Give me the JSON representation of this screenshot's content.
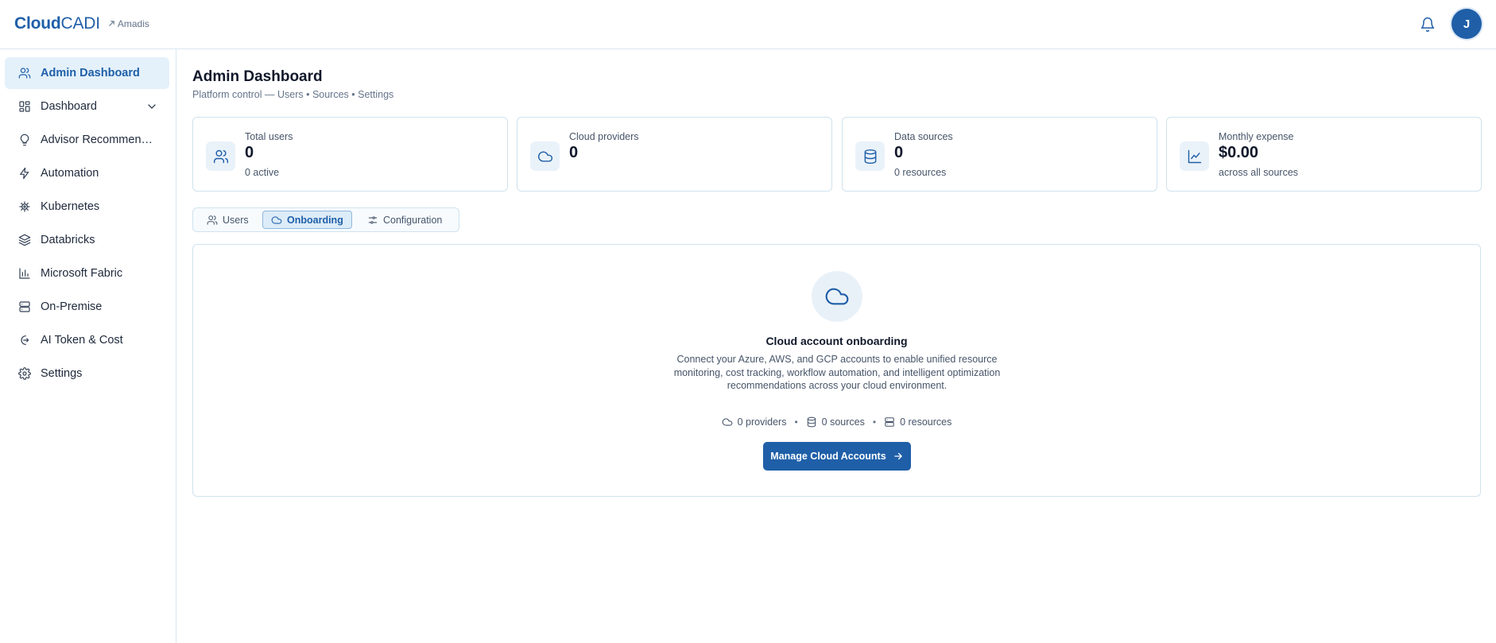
{
  "header": {
    "brand_strong": "Cloud",
    "brand_light": "CADI",
    "tenant": "Amadis",
    "avatar_initial": "J",
    "icons": {
      "tenant": "external-link-icon",
      "notifications": "bell-icon"
    }
  },
  "colors": {
    "primary": "#1f5fa8",
    "active_nav_bg": "#e4f1fb",
    "border": "#cfe2ee",
    "text_muted": "#475569"
  },
  "sidebar": {
    "items": [
      {
        "label": "Admin Dashboard",
        "icon": "users-icon",
        "active": true
      },
      {
        "label": "Dashboard",
        "icon": "grid-icon",
        "expandable": true
      },
      {
        "label": "Advisor Recommendations",
        "icon": "lightbulb-icon"
      },
      {
        "label": "Automation",
        "icon": "lightning-icon"
      },
      {
        "label": "Kubernetes",
        "icon": "helm-icon"
      },
      {
        "label": "Databricks",
        "icon": "layers-icon"
      },
      {
        "label": "Microsoft Fabric",
        "icon": "bar-chart-icon"
      },
      {
        "label": "On-Premise",
        "icon": "server-icon"
      },
      {
        "label": "AI Token & Cost",
        "icon": "token-icon"
      },
      {
        "label": "Settings",
        "icon": "gear-icon"
      }
    ]
  },
  "main": {
    "title": "Admin Dashboard",
    "subtitle": "Platform control — Users • Sources • Settings",
    "stats": [
      {
        "label": "Total users",
        "value": "0",
        "sub": "0 active",
        "icon": "users-icon"
      },
      {
        "label": "Cloud providers",
        "value": "0",
        "sub": "",
        "icon": "cloud-icon"
      },
      {
        "label": "Data sources",
        "value": "0",
        "sub": "0 resources",
        "icon": "database-icon"
      },
      {
        "label": "Monthly expense",
        "value": "$0.00",
        "sub": "across all sources",
        "icon": "line-chart-icon"
      }
    ],
    "tabs": [
      {
        "label": "Users",
        "icon": "users-icon",
        "active": false
      },
      {
        "label": "Onboarding",
        "icon": "cloud-icon",
        "active": true
      },
      {
        "label": "Configuration",
        "icon": "sliders-icon",
        "active": false
      }
    ],
    "onboarding": {
      "icon": "cloud-icon",
      "title": "Cloud account onboarding",
      "description": "Connect your Azure, AWS, and GCP accounts to enable unified resource monitoring, cost tracking, workflow automation, and intelligent optimization recommendations across your cloud environment.",
      "stats": {
        "providers": "0 providers",
        "sources": "0 sources",
        "resources": "0 resources",
        "separator": "•"
      },
      "button_label": "Manage Cloud Accounts",
      "button_icon": "arrow-right-icon"
    }
  }
}
